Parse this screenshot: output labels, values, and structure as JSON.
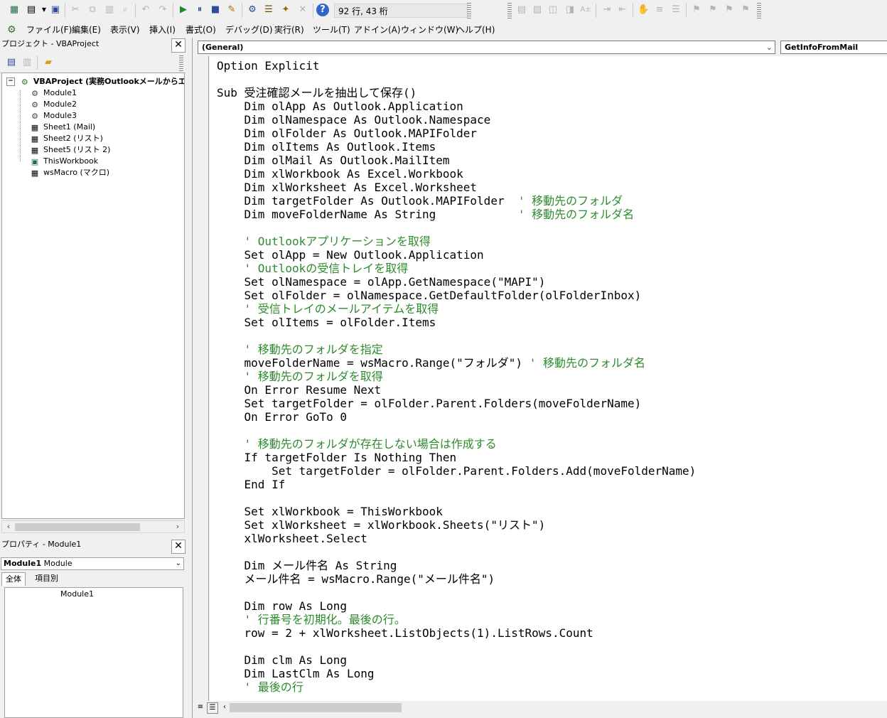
{
  "toolbar": {
    "position_status": "92 行, 43 桁",
    "icons": [
      "excel-icon",
      "insert-userform-icon",
      "save-icon",
      "cut-icon",
      "copy-icon",
      "paste-icon",
      "find-icon",
      "undo-icon",
      "redo-icon",
      "run-icon",
      "break-icon",
      "reset-icon",
      "design-mode-icon",
      "project-explorer-icon",
      "properties-icon",
      "object-browser-icon",
      "toolbox-icon",
      "help-icon"
    ]
  },
  "menu": {
    "items": [
      "ファイル(F)",
      "編集(E)",
      "表示(V)",
      "挿入(I)",
      "書式(O)",
      "デバッグ(D)",
      "実行(R)",
      "ツール(T)",
      "アドイン(A)",
      "ウィンドウ(W)",
      "ヘルプ(H)"
    ]
  },
  "project": {
    "title": "プロジェクト - VBAProject",
    "root": "VBAProject (実務Outlookメールからエ",
    "items": [
      {
        "label": "Module1",
        "icon": "module-icon"
      },
      {
        "label": "Module2",
        "icon": "module-icon"
      },
      {
        "label": "Module3",
        "icon": "module-icon"
      },
      {
        "label": "Sheet1 (Mail)",
        "icon": "sheet-icon"
      },
      {
        "label": "Sheet2 (リスト)",
        "icon": "sheet-icon"
      },
      {
        "label": "Sheet5 (リスト 2)",
        "icon": "sheet-icon"
      },
      {
        "label": "ThisWorkbook",
        "icon": "workbook-icon"
      },
      {
        "label": "wsMacro (マクロ)",
        "icon": "sheet-icon"
      }
    ]
  },
  "properties": {
    "title": "プロパティ - Module1",
    "object_name": "Module1",
    "object_type": "Module",
    "tabs": [
      "全体",
      "項目別"
    ],
    "rows": [
      "Module1"
    ]
  },
  "code": {
    "object_combo": "(General)",
    "proc_combo": "GetInfoFromMail",
    "comment_color": "#2e8b2e",
    "lines": [
      {
        "t": "Option Explicit"
      },
      {
        "t": ""
      },
      {
        "t": "Sub 受注確認メールを抽出して保存()"
      },
      {
        "t": "    Dim olApp As Outlook.Application"
      },
      {
        "t": "    Dim olNamespace As Outlook.Namespace"
      },
      {
        "t": "    Dim olFolder As Outlook.MAPIFolder"
      },
      {
        "t": "    Dim olItems As Outlook.Items"
      },
      {
        "t": "    Dim olMail As Outlook.MailItem"
      },
      {
        "t": "    Dim xlWorkbook As Excel.Workbook"
      },
      {
        "t": "    Dim xlWorksheet As Excel.Worksheet"
      },
      {
        "t": "    Dim targetFolder As Outlook.MAPIFolder  ",
        "c": "' 移動先のフォルダ"
      },
      {
        "t": "    Dim moveFolderName As String            ",
        "c": "' 移動先のフォルダ名"
      },
      {
        "t": ""
      },
      {
        "t": "    ",
        "c": "' Outlookアプリケーションを取得"
      },
      {
        "t": "    Set olApp = New Outlook.Application"
      },
      {
        "t": "    ",
        "c": "' Outlookの受信トレイを取得"
      },
      {
        "t": "    Set olNamespace = olApp.GetNamespace(\"MAPI\")"
      },
      {
        "t": "    Set olFolder = olNamespace.GetDefaultFolder(olFolderInbox)"
      },
      {
        "t": "    ",
        "c": "' 受信トレイのメールアイテムを取得"
      },
      {
        "t": "    Set olItems = olFolder.Items"
      },
      {
        "t": ""
      },
      {
        "t": "    ",
        "c": "' 移動先のフォルダを指定"
      },
      {
        "t": "    moveFolderName = wsMacro.Range(\"フォルダ\") ",
        "c": "' 移動先のフォルダ名"
      },
      {
        "t": "    ",
        "c": "' 移動先のフォルダを取得"
      },
      {
        "t": "    On Error Resume Next"
      },
      {
        "t": "    Set targetFolder = olFolder.Parent.Folders(moveFolderName)"
      },
      {
        "t": "    On Error GoTo 0"
      },
      {
        "t": ""
      },
      {
        "t": "    ",
        "c": "' 移動先のフォルダが存在しない場合は作成する"
      },
      {
        "t": "    If targetFolder Is Nothing Then"
      },
      {
        "t": "        Set targetFolder = olFolder.Parent.Folders.Add(moveFolderName)"
      },
      {
        "t": "    End If"
      },
      {
        "t": ""
      },
      {
        "t": "    Set xlWorkbook = ThisWorkbook"
      },
      {
        "t": "    Set xlWorksheet = xlWorkbook.Sheets(\"リスト\")"
      },
      {
        "t": "    xlWorksheet.Select"
      },
      {
        "t": ""
      },
      {
        "t": "    Dim メール件名 As String"
      },
      {
        "t": "    メール件名 = wsMacro.Range(\"メール件名\")"
      },
      {
        "t": ""
      },
      {
        "t": "    Dim row As Long"
      },
      {
        "t": "    ",
        "c": "' 行番号を初期化。最後の行。"
      },
      {
        "t": "    row = 2 + xlWorksheet.ListObjects(1).ListRows.Count"
      },
      {
        "t": ""
      },
      {
        "t": "    Dim clm As Long"
      },
      {
        "t": "    Dim LastClm As Long"
      },
      {
        "t": "    ",
        "c": "' 最後の行"
      }
    ]
  }
}
